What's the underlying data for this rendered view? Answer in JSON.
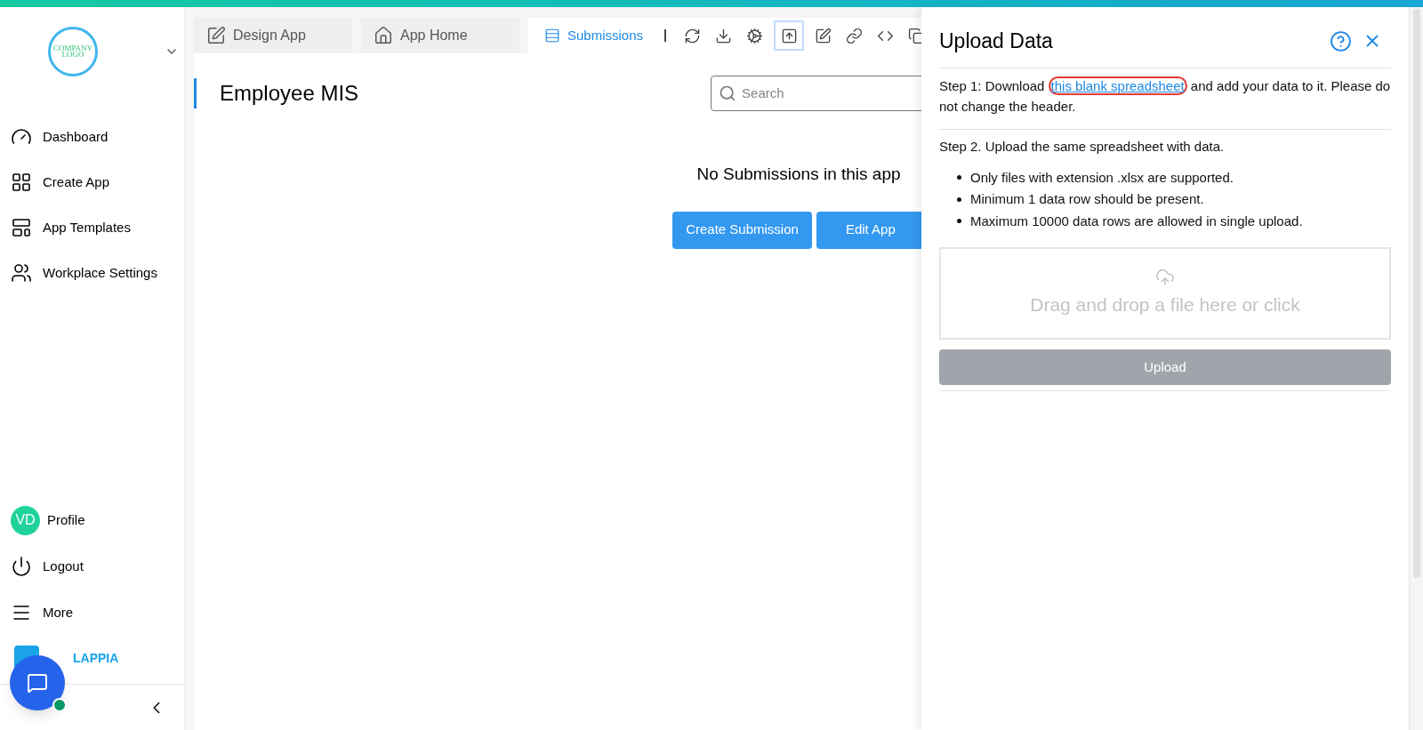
{
  "logo": {
    "lines": [
      "COMPANY",
      "LOGO"
    ]
  },
  "sidebar": {
    "items": [
      {
        "kind": "dashboard",
        "label": "Dashboard"
      },
      {
        "kind": "create",
        "label": "Create App"
      },
      {
        "kind": "templates",
        "label": "App Templates"
      },
      {
        "kind": "users",
        "label": "Workplace Settings"
      }
    ],
    "bottom_items": [
      {
        "kind": "avatar",
        "initials": "VD",
        "label": "Profile"
      },
      {
        "kind": "logout",
        "label": "Logout"
      },
      {
        "kind": "more",
        "label": "More"
      }
    ],
    "brand": "LAPPIA"
  },
  "tabs": [
    {
      "kind": "design",
      "label": "Design App",
      "selected": false
    },
    {
      "kind": "home",
      "label": "App Home",
      "selected": false
    },
    {
      "kind": "submissions",
      "label": "Submissions",
      "selected": true
    }
  ],
  "toolbar": [
    {
      "kind": "refresh",
      "selected": false
    },
    {
      "kind": "download",
      "selected": false
    },
    {
      "kind": "settings",
      "selected": false
    },
    {
      "kind": "upload",
      "selected": true
    },
    {
      "kind": "edit",
      "selected": false
    },
    {
      "kind": "link",
      "selected": false
    },
    {
      "kind": "code",
      "selected": false
    },
    {
      "kind": "copy",
      "selected": false
    }
  ],
  "page": {
    "title": "Employee MIS",
    "search": {
      "placeholder": "Search"
    },
    "empty_message": "No Submissions in this app",
    "buttons": [
      "Create Submission",
      "Edit App"
    ]
  },
  "drawer": {
    "title": "Upload Data",
    "step1": {
      "before": "Step 1: Download ",
      "link": "this blank spreadsheet",
      "after": " and add your data to it. Please do not change the header."
    },
    "step2": "Step 2. Upload the same spreadsheet with data.",
    "rules": [
      "Only files with extension .xlsx are supported.",
      "Minimum 1 data row should be present.",
      "Maximum 10000 data rows are allowed in single upload."
    ],
    "dropzone": "Drag and drop a file here or click",
    "upload_button": "Upload"
  }
}
